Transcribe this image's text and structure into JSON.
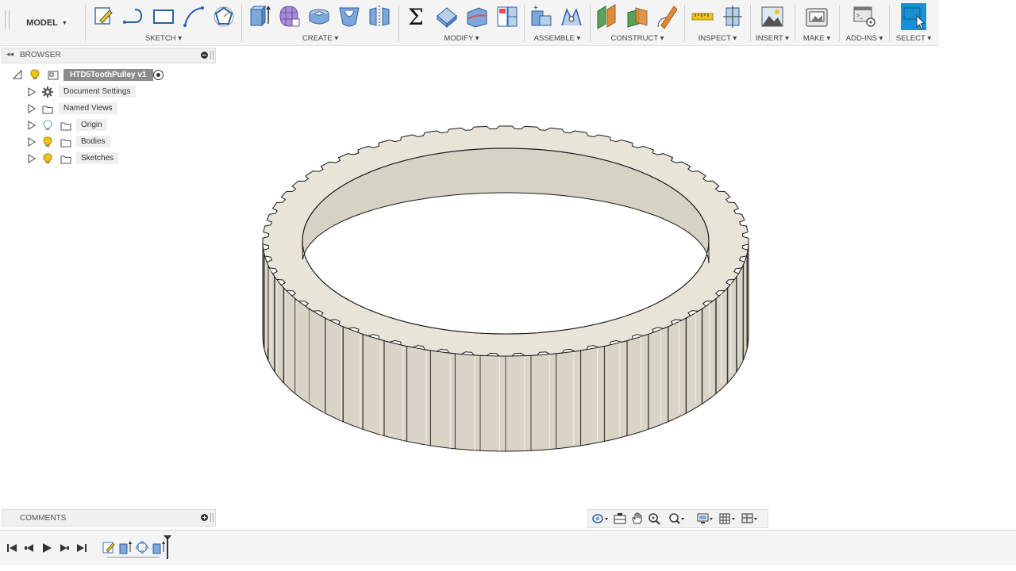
{
  "toolbar": {
    "workspace": "MODEL",
    "groups": {
      "sketch": "SKETCH",
      "create": "CREATE",
      "modify": "MODIFY",
      "assemble": "ASSEMBLE",
      "construct": "CONSTRUCT",
      "inspect": "INSPECT",
      "insert": "INSERT",
      "make": "MAKE",
      "addins": "ADD-INS",
      "select": "SELECT"
    }
  },
  "browser": {
    "title": "BROWSER",
    "root": "HTD5ToothPulley v1",
    "items": [
      {
        "label": "Document Settings",
        "icon": "gear-icon"
      },
      {
        "label": "Named Views",
        "icon": "folder-icon"
      },
      {
        "label": "Origin",
        "icon": "folder-icon"
      },
      {
        "label": "Bodies",
        "icon": "folder-icon"
      },
      {
        "label": "Sketches",
        "icon": "folder-icon"
      }
    ]
  },
  "comments": {
    "title": "COMMENTS"
  },
  "colors": {
    "toolbar_bg": "#f4f4f4",
    "select_accent": "#1a8fd1",
    "model_face": "#e8e4d8",
    "model_side": "#d9d4c6",
    "edge": "#1a1a1a",
    "bulb_on": "#f3c316",
    "bulb_off": "#6a9fd8"
  }
}
